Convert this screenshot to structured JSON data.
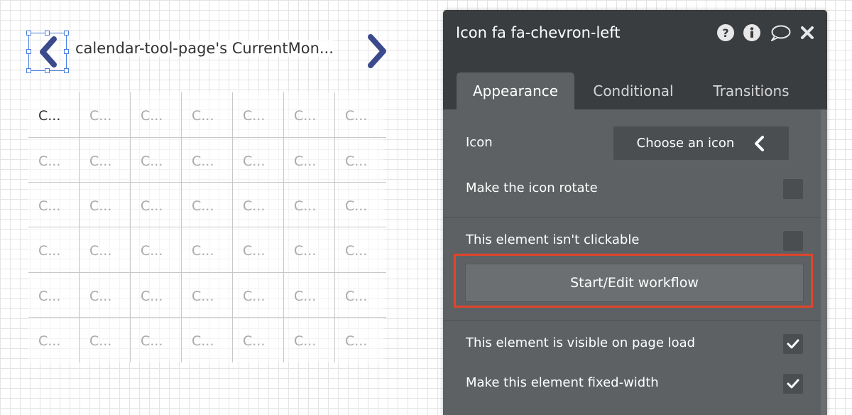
{
  "canvas": {
    "month_label": "calendar-tool-page's CurrentMon...",
    "prev_icon": "chevron-left-icon",
    "next_icon": "chevron-right-icon",
    "grid_cells": [
      [
        "C...",
        "C...",
        "C...",
        "C...",
        "C...",
        "C...",
        "C..."
      ],
      [
        "C...",
        "C...",
        "C...",
        "C...",
        "C...",
        "C...",
        "C..."
      ],
      [
        "C...",
        "C...",
        "C...",
        "C...",
        "C...",
        "C...",
        "C..."
      ],
      [
        "C...",
        "C...",
        "C...",
        "C...",
        "C...",
        "C...",
        "C..."
      ],
      [
        "C...",
        "C...",
        "C...",
        "C...",
        "C...",
        "C...",
        "C..."
      ],
      [
        "C...",
        "C...",
        "C...",
        "C...",
        "C...",
        "C...",
        "C..."
      ]
    ],
    "chevron_color": "#3a4a8c",
    "selection_color": "#4a7ee0"
  },
  "panel": {
    "title": "Icon fa fa-chevron-left",
    "header_icons": [
      "help-icon",
      "info-icon",
      "comment-icon",
      "close-icon"
    ],
    "tabs": [
      {
        "label": "Appearance",
        "active": true
      },
      {
        "label": "Conditional",
        "active": false
      },
      {
        "label": "Transitions",
        "active": false
      }
    ],
    "icon_label": "Icon",
    "icon_picker_label": "Choose an icon",
    "rotate_label": "Make the icon rotate",
    "rotate_checked": false,
    "not_clickable_label": "This element isn't clickable",
    "not_clickable_checked": false,
    "workflow_button": "Start/Edit workflow",
    "visible_label": "This element is visible on page load",
    "visible_checked": true,
    "fixed_width_label": "Make this element fixed-width",
    "fixed_width_checked": true,
    "highlight_color": "#e0442c"
  }
}
